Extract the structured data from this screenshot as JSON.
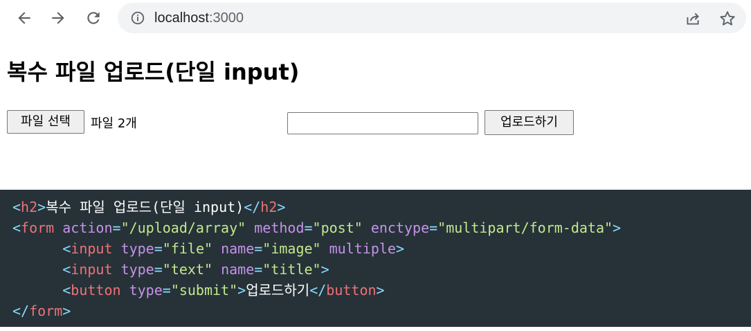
{
  "browser": {
    "url_host": "localhost",
    "url_port": ":3000",
    "icons": [
      "back-arrow-icon",
      "forward-arrow-icon",
      "reload-icon",
      "info-icon",
      "share-icon",
      "star-icon"
    ]
  },
  "page": {
    "title": "복수 파일 업로드(단일 input)",
    "file_button_label": "파일 선택",
    "file_status": "파일 2개",
    "text_input_value": "",
    "submit_label": "업로드하기"
  },
  "code": {
    "line1": {
      "text": "복수 파일 업로드(단일 input)"
    },
    "line2": {
      "tag": "form",
      "attr1": "action",
      "val1": "\"/upload/array\"",
      "attr2": "method",
      "val2": "\"post\"",
      "attr3": "enctype",
      "val3": "\"multipart/form-data\""
    },
    "line3": {
      "tag": "input",
      "attr1": "type",
      "val1": "\"file\"",
      "attr2": "name",
      "val2": "\"image\"",
      "attr3": "multiple"
    },
    "line4": {
      "tag": "input",
      "attr1": "type",
      "val1": "\"text\"",
      "attr2": "name",
      "val2": "\"title\""
    },
    "line5": {
      "tag": "button",
      "attr1": "type",
      "val1": "\"submit\"",
      "text": "업로드하기"
    },
    "line6": {
      "tag": "form"
    },
    "h2_tag": "h2",
    "eq": "="
  },
  "colors": {
    "code_bg": "#263238",
    "tag": "#f07178",
    "punct": "#89ddff",
    "attr": "#c792ea",
    "string": "#c3e88d",
    "omnibox_bg": "#f1f3f4"
  }
}
